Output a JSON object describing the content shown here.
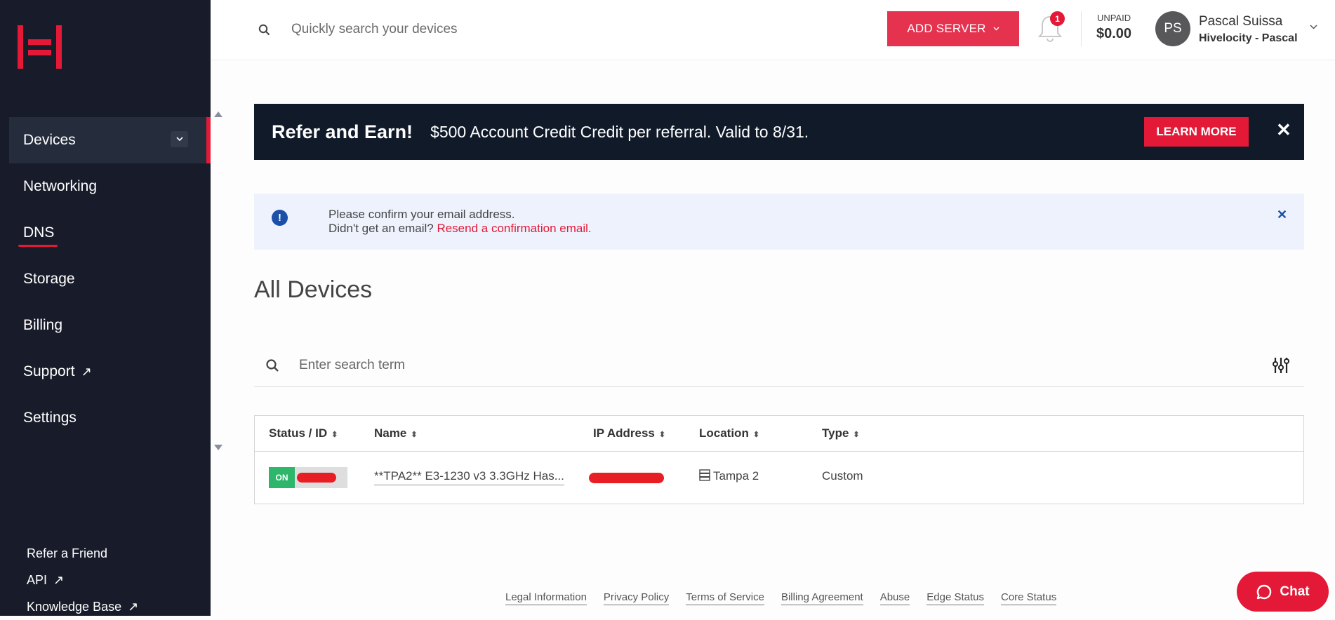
{
  "brand": {
    "accent": "#e31937",
    "sidebar_bg": "#181c2a",
    "logo_icon": "hivelocity-logo"
  },
  "sidebar": {
    "items": [
      {
        "label": "Devices",
        "active": true,
        "expandable": true
      },
      {
        "label": "Networking"
      },
      {
        "label": "DNS",
        "underlined": true
      },
      {
        "label": "Storage"
      },
      {
        "label": "Billing"
      },
      {
        "label": "Support",
        "external": true
      },
      {
        "label": "Settings"
      }
    ],
    "external_icon": "↗",
    "toggle_icon": "chevron-down-icon",
    "secondary": [
      {
        "label": "Refer a Friend"
      },
      {
        "label": "API",
        "external": true
      },
      {
        "label": "Knowledge Base",
        "external": true
      }
    ]
  },
  "header": {
    "search_placeholder": "Quickly search your devices",
    "add_server_label": "ADD SERVER",
    "notification_count": "1",
    "unpaid_label": "UNPAID",
    "unpaid_amount": "$0.00",
    "avatar_initials": "PS",
    "user_name": "Pascal Suissa",
    "user_org": "Hivelocity - Pascal"
  },
  "promo": {
    "title": "Refer and Earn!",
    "text": "$500 Account Credit Credit per referral. Valid to 8/31.",
    "button_label": "LEARN MORE",
    "close_glyph": "✕"
  },
  "alert": {
    "icon_glyph": "!",
    "line1": "Please confirm your email address.",
    "line2_prefix": "Didn't get an email? ",
    "line2_link": "Resend a confirmation email.",
    "close_glyph": "✕"
  },
  "main": {
    "title": "All Devices",
    "search_placeholder": "Enter search term"
  },
  "table": {
    "columns": [
      {
        "label": "Status / ID"
      },
      {
        "label": "Name"
      },
      {
        "label": "IP Address"
      },
      {
        "label": "Location"
      },
      {
        "label": "Type"
      }
    ],
    "sort_glyph": "⬍",
    "rows": [
      {
        "status": "ON",
        "id": "[redacted]",
        "name": "**TPA2** E3-1230 v3 3.3GHz Has...",
        "ip": "[redacted]",
        "location": "Tampa 2",
        "type": "Custom"
      }
    ]
  },
  "footer": {
    "links": [
      "Legal Information",
      "Privacy Policy",
      "Terms of Service",
      "Billing Agreement",
      "Abuse",
      "Edge Status",
      "Core Status"
    ]
  },
  "chat": {
    "label": "Chat"
  }
}
